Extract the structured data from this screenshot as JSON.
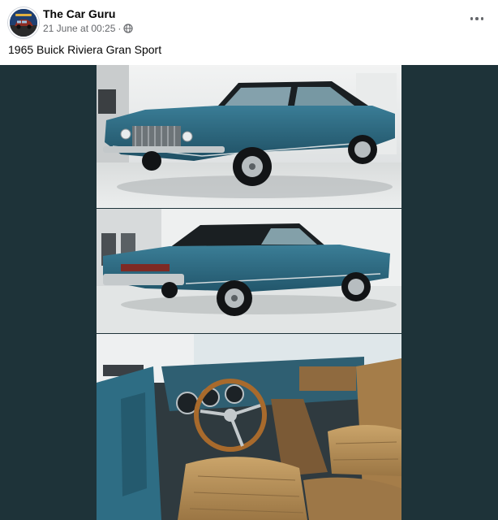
{
  "post": {
    "author": "The Car Guru",
    "timestamp": "21 June at 00:25",
    "separator": "·",
    "audience_icon": "globe-icon",
    "caption": "1965 Buick Riviera Gran Sport",
    "more_icon": "more-options-icon"
  },
  "colors": {
    "media_background": "#1e3339",
    "car_paint": "#2f6e86",
    "interior": "#b48c52",
    "meta_text": "#65676b"
  },
  "photos": [
    {
      "subject": "front three-quarter exterior",
      "icon": "photo-1"
    },
    {
      "subject": "rear three-quarter exterior",
      "icon": "photo-2"
    },
    {
      "subject": "interior dashboard and seats",
      "icon": "photo-3"
    }
  ]
}
